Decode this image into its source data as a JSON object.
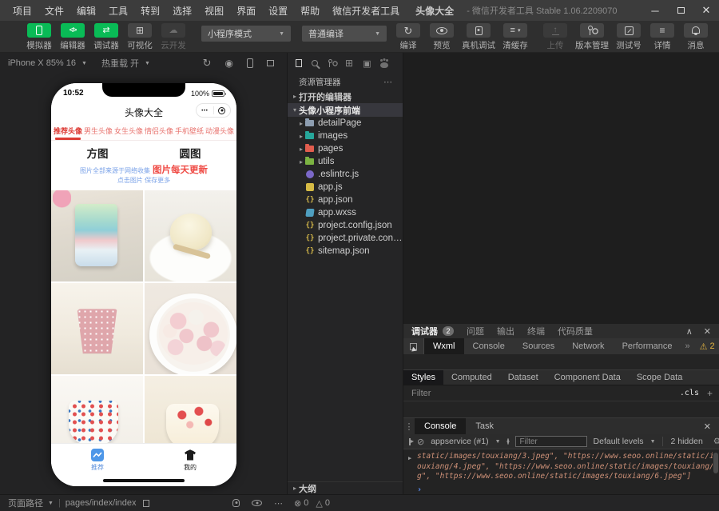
{
  "titlebar": {
    "menus": [
      "项目",
      "文件",
      "编辑",
      "工具",
      "转到",
      "选择",
      "视图",
      "界面",
      "设置",
      "帮助",
      "微信开发者工具"
    ],
    "project": "头像大全",
    "suffix": "- 微信开发者工具 Stable 1.06.2209070"
  },
  "toolbar": {
    "buttons_main": [
      {
        "label": "模拟器",
        "icon": "simulator-icon",
        "style": "green"
      },
      {
        "label": "编辑器",
        "icon": "editor-icon",
        "style": "green"
      },
      {
        "label": "调试器",
        "icon": "debugger-icon",
        "style": "green"
      },
      {
        "label": "可视化",
        "icon": "visual-icon",
        "style": "gray"
      },
      {
        "label": "云开发",
        "icon": "cloud-icon",
        "style": "disabled"
      }
    ],
    "mode_select": "小程序模式",
    "compile_select": "普通编译",
    "buttons_compile": [
      {
        "label": "编译",
        "icon": "compile-icon",
        "style": "gray"
      },
      {
        "label": "预览",
        "icon": "preview-icon",
        "style": "gray"
      },
      {
        "label": "真机调试",
        "icon": "device-debug-icon",
        "style": "gray"
      },
      {
        "label": "清缓存",
        "icon": "cache-icon",
        "style": "gray",
        "caret": true
      }
    ],
    "buttons_right": [
      {
        "label": "上传",
        "icon": "upload-icon",
        "style": "disabled"
      },
      {
        "label": "版本管理",
        "icon": "version-icon",
        "style": "gray"
      },
      {
        "label": "测试号",
        "icon": "test-icon",
        "style": "gray"
      },
      {
        "label": "详情",
        "icon": "details-icon",
        "style": "gray"
      },
      {
        "label": "消息",
        "icon": "message-icon",
        "style": "gray"
      }
    ]
  },
  "simulator": {
    "device": "iPhone X 85% 16",
    "hot_reload": "热重载 开",
    "phone": {
      "time": "10:52",
      "battery": "100%",
      "nav_title": "头像大全",
      "capsule_more": "•••",
      "category_tabs": [
        "推荐头像",
        "男生头像",
        "女生头像",
        "情侣头像",
        "手机壁纸",
        "动漫头像"
      ],
      "active_category": 0,
      "shape_tabs": [
        "方图",
        "圆图"
      ],
      "notice_source": "图片全部来源于网络收集",
      "notice_update": "图片每天更新",
      "notice_hint": "点击图片 保存更多",
      "photos": [
        "rainbow-drink-photo",
        "mochi-dessert-photo",
        "floral-cup-photo",
        "tangyuan-bowl-photo",
        "hearts-cup-photo",
        "strawberry-cup-photo"
      ],
      "tab_bar": [
        {
          "label": "推荐",
          "active": true
        },
        {
          "label": "我的",
          "active": false
        }
      ]
    }
  },
  "explorer": {
    "title": "资源管理器",
    "open_editors": "打开的编辑器",
    "project_root": "头像小程序前端",
    "outline": "大纲",
    "tree": [
      {
        "name": "detailPage",
        "kind": "folder",
        "color": "#8d9db0"
      },
      {
        "name": "images",
        "kind": "folder",
        "color": "#26a69a"
      },
      {
        "name": "pages",
        "kind": "folder",
        "color": "#e25d4e"
      },
      {
        "name": "utils",
        "kind": "folder",
        "color": "#7cb342"
      },
      {
        "name": ".eslintrc.js",
        "kind": "eslint"
      },
      {
        "name": "app.js",
        "kind": "js"
      },
      {
        "name": "app.json",
        "kind": "json"
      },
      {
        "name": "app.wxss",
        "kind": "wxss"
      },
      {
        "name": "project.config.json",
        "kind": "json"
      },
      {
        "name": "project.private.config.js...",
        "kind": "json"
      },
      {
        "name": "sitemap.json",
        "kind": "json"
      }
    ]
  },
  "debugger": {
    "panel_title": "调试器",
    "panel_badge": "2",
    "panel_tabs": [
      "问题",
      "输出",
      "终端",
      "代码质量"
    ],
    "devtools_tabs": [
      "Wxml",
      "Console",
      "Sources",
      "Network",
      "Performance"
    ],
    "active_devtools_tab": 0,
    "warning_count": "2",
    "styles_tabs": [
      "Styles",
      "Computed",
      "Dataset",
      "Component Data",
      "Scope Data"
    ],
    "active_styles_tab": 0,
    "filter_placeholder": "Filter",
    "cls_button": ".cls",
    "console": {
      "tabs": [
        "Console",
        "Task"
      ],
      "active_tab": 0,
      "context": "appservice (#1)",
      "filter_placeholder": "Filter",
      "levels": "Default levels",
      "hidden": "2 hidden",
      "log_lines": [
        "static/images/touxiang/3.jpeg\", \"https://www.seoo.online/static/images/t",
        "ouxiang/4.jpeg\", \"https://www.seoo.online/static/images/touxiang/5.jpe",
        "g\", \"https://www.seoo.online/static/images/touxiang/6.jpeg\"]"
      ]
    }
  },
  "statusbar": {
    "path_label": "页面路径",
    "path_value": "pages/index/index",
    "error_count": "0",
    "warning_count": "0"
  },
  "colors": {
    "wechat_green": "#09bb56",
    "accent_red": "#dd3b35",
    "link_blue": "#7aa2e8",
    "log_orange": "#ce9178",
    "warn_yellow": "#e2b341"
  }
}
